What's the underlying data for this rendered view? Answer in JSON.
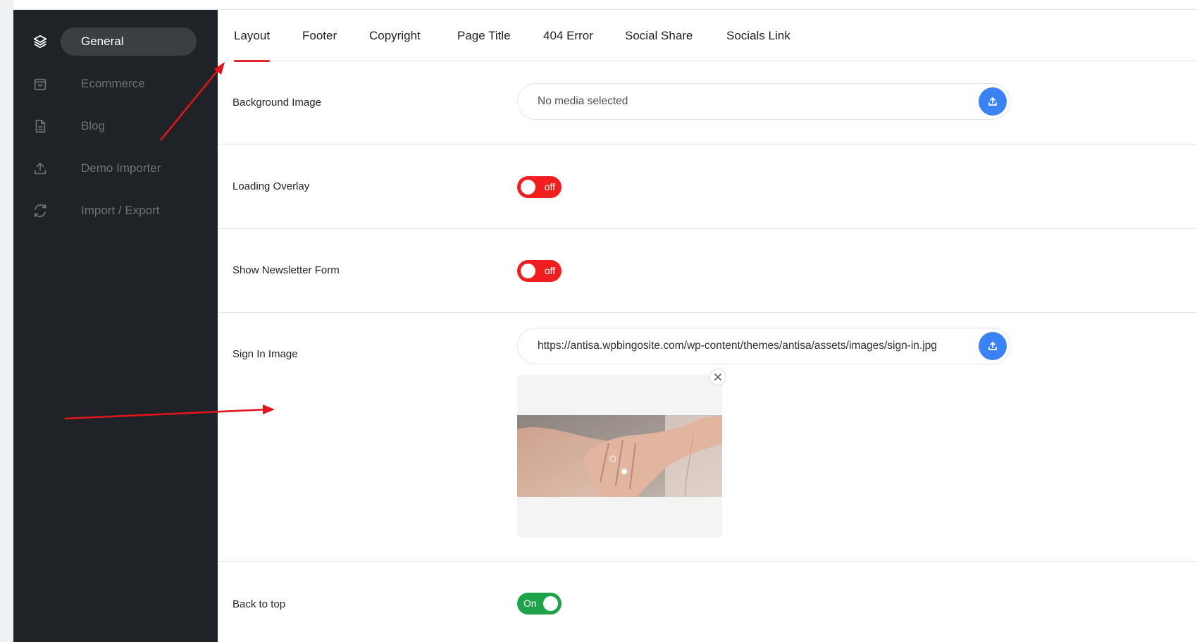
{
  "sidebar": {
    "items": [
      {
        "label": "General",
        "icon": "layers-icon",
        "active": true
      },
      {
        "label": "Ecommerce",
        "icon": "shopping-bag-icon",
        "active": false
      },
      {
        "label": "Blog",
        "icon": "document-icon",
        "active": false
      },
      {
        "label": "Demo Importer",
        "icon": "upload-icon",
        "active": false
      },
      {
        "label": "Import / Export",
        "icon": "refresh-icon",
        "active": false
      }
    ]
  },
  "tabs": [
    {
      "label": "Layout",
      "active": true
    },
    {
      "label": "Footer",
      "active": false
    },
    {
      "label": "Copyright",
      "active": false
    },
    {
      "label": "Page Title",
      "active": false
    },
    {
      "label": "404 Error",
      "active": false
    },
    {
      "label": "Social Share",
      "active": false
    },
    {
      "label": "Socials Link",
      "active": false
    }
  ],
  "settings": {
    "background_image": {
      "label": "Background Image",
      "value": "",
      "placeholder": "No media selected"
    },
    "loading_overlay": {
      "label": "Loading Overlay",
      "state": "off",
      "state_label": "off"
    },
    "newsletter_form": {
      "label": "Show Newsletter Form",
      "state": "off",
      "state_label": "off"
    },
    "sign_in_image": {
      "label": "Sign In Image",
      "value": "https://antisa.wpbingosite.com/wp-content/themes/antisa/assets/images/sign-in.jpg",
      "placeholder": ""
    },
    "back_to_top": {
      "label": "Back to top",
      "state": "on",
      "state_label": "On"
    }
  },
  "colors": {
    "sidebar_bg": "#1f2327",
    "accent_tab": "#e0282e",
    "toggle_off": "#f01e1e",
    "toggle_on": "#1fa34a",
    "upload_button": "#3b82f6",
    "annotation_arrow": "#e0161b"
  }
}
